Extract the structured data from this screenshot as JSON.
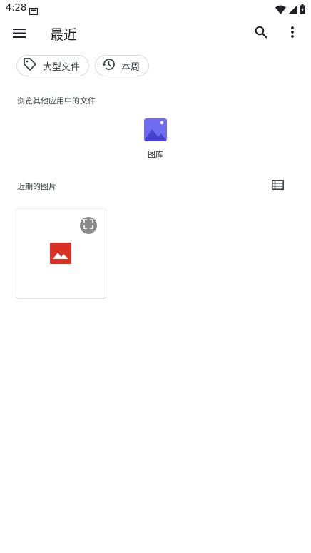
{
  "status_bar": {
    "time": "4:28"
  },
  "app_bar": {
    "title": "最近"
  },
  "chips": [
    {
      "label": "大型文件",
      "icon": "tag-icon"
    },
    {
      "label": "本周",
      "icon": "history-icon"
    }
  ],
  "browse_section": {
    "heading": "浏览其他应用中的文件",
    "apps": [
      {
        "label": "图库",
        "icon": "gallery-app-icon"
      }
    ]
  },
  "recent_section": {
    "heading": "近期的图片",
    "view_toggle_icon": "list-view-icon",
    "items": [
      {
        "type": "image",
        "icon": "image-file-icon"
      }
    ]
  },
  "colors": {
    "gallery_icon": "#6f6cf2",
    "image_icon": "#d93025",
    "chip_border": "#dadce0"
  }
}
